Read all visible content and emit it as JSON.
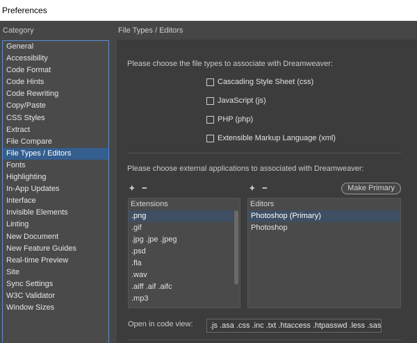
{
  "window": {
    "title": "Preferences"
  },
  "category": {
    "label": "Category",
    "items": [
      "General",
      "Accessibility",
      "Code Format",
      "Code Hints",
      "Code Rewriting",
      "Copy/Paste",
      "CSS Styles",
      "Extract",
      "File Compare",
      "File Types / Editors",
      "Fonts",
      "Highlighting",
      "In-App Updates",
      "Interface",
      "Invisible Elements",
      "Linting",
      "New Document",
      "New Feature Guides",
      "Real-time Preview",
      "Site",
      "Sync Settings",
      "W3C Validator",
      "Window Sizes"
    ],
    "selected": "File Types / Editors"
  },
  "section": {
    "title": "File Types / Editors",
    "filetypes_prompt": "Please choose the file types to associate with Dreamweaver:",
    "checkboxes": [
      {
        "label": "Cascading Style Sheet (css)",
        "checked": false
      },
      {
        "label": "JavaScript (js)",
        "checked": false
      },
      {
        "label": "PHP (php)",
        "checked": false
      },
      {
        "label": "Extensible Markup Language (xml)",
        "checked": false
      }
    ],
    "apps_prompt": "Please choose external applications to associated with Dreamweaver:",
    "plus": "+",
    "minus": "−",
    "make_primary": "Make Primary",
    "extensions_header": "Extensions",
    "extensions": [
      ".png",
      ".gif",
      ".jpg .jpe .jpeg",
      ".psd",
      ".fla",
      ".wav",
      ".aiff .aif .aifc",
      ".mp3"
    ],
    "extensions_selected": ".png",
    "editors_header": "Editors",
    "editors": [
      "Photoshop (Primary)",
      "Photoshop"
    ],
    "editors_selected": "Photoshop (Primary)",
    "open_in_code_label": "Open in code view:",
    "open_in_code_value": ".js .asa .css .inc .txt .htaccess .htpasswd .less .sass .scss"
  }
}
